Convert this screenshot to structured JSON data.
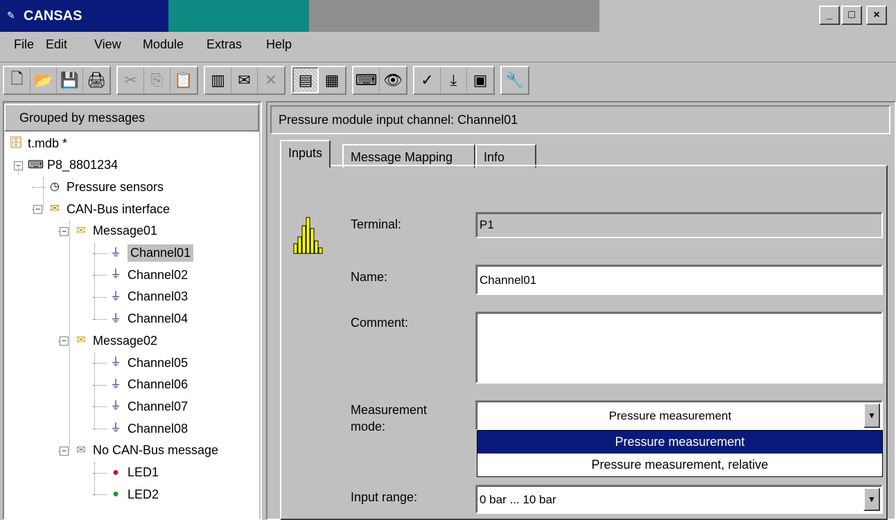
{
  "window": {
    "title": "CANSAS",
    "icon": "cansas-app-icon",
    "controls": [
      "_",
      "□",
      "×"
    ]
  },
  "menu": [
    {
      "label": "File"
    },
    {
      "label": "Edit"
    },
    {
      "label": "View"
    },
    {
      "label": "Module"
    },
    {
      "label": "Extras"
    },
    {
      "label": "Help"
    }
  ],
  "toolbar": {
    "groups": [
      [
        "new-file-icon",
        "open-folder-icon",
        "save-icon",
        "print-icon"
      ],
      [
        "cut-icon",
        "copy-icon",
        "paste-icon"
      ],
      [
        "add-channel-icon",
        "add-message-icon",
        "delete-icon"
      ],
      [
        "group-by-messages-icon",
        "group-by-channels-icon"
      ],
      [
        "module-icon",
        "search-icon"
      ],
      [
        "check-icon",
        "download-icon",
        "display-icon"
      ],
      [
        "wrench-icon"
      ]
    ],
    "glyphs": {
      "new-file-icon": "🗋",
      "open-folder-icon": "📂",
      "save-icon": "💾",
      "print-icon": "🖨",
      "cut-icon": "✂",
      "copy-icon": "⎘",
      "paste-icon": "📋",
      "add-channel-icon": "▥",
      "add-message-icon": "✉",
      "delete-icon": "✕",
      "group-by-messages-icon": "▤",
      "group-by-channels-icon": "▦",
      "module-icon": "⌨",
      "search-icon": "👁",
      "check-icon": "✓",
      "download-icon": "⤓",
      "display-icon": "▣",
      "wrench-icon": "🔧"
    },
    "disabled": [
      "cut-icon",
      "copy-icon",
      "paste-icon",
      "delete-icon",
      "wrench-icon"
    ],
    "pressed": [
      "group-by-messages-icon"
    ]
  },
  "left_panel": {
    "header": "Grouped by messages",
    "tree": [
      {
        "label": "t.mdb *",
        "icon": "database-icon",
        "level": 0
      },
      {
        "label": "P8_8801234",
        "icon": "module-icon",
        "level": 1,
        "expander": "−"
      },
      {
        "label": "Pressure sensors",
        "icon": "gauge-icon",
        "level": 2
      },
      {
        "label": "CAN-Bus interface",
        "icon": "can-bus-icon",
        "level": 2,
        "expander": "−"
      },
      {
        "label": "Message01",
        "icon": "envelope-icon",
        "level": 3,
        "expander": "−"
      },
      {
        "label": "Channel01",
        "icon": "channel-icon",
        "level": 4,
        "selected": true
      },
      {
        "label": "Channel02",
        "icon": "channel-icon",
        "level": 4
      },
      {
        "label": "Channel03",
        "icon": "channel-icon",
        "level": 4
      },
      {
        "label": "Channel04",
        "icon": "channel-icon",
        "level": 4
      },
      {
        "label": "Message02",
        "icon": "envelope-icon",
        "level": 3,
        "expander": "−"
      },
      {
        "label": "Channel05",
        "icon": "channel-icon",
        "level": 4
      },
      {
        "label": "Channel06",
        "icon": "channel-icon",
        "level": 4
      },
      {
        "label": "Channel07",
        "icon": "channel-icon",
        "level": 4
      },
      {
        "label": "Channel08",
        "icon": "channel-icon",
        "level": 4
      },
      {
        "label": "No CAN-Bus message",
        "icon": "no-message-icon",
        "level": 3,
        "expander": "−"
      },
      {
        "label": "LED1",
        "icon": "led-red-icon",
        "level": 4
      },
      {
        "label": "LED2",
        "icon": "led-green-icon",
        "level": 4
      }
    ]
  },
  "right_panel": {
    "header": "Pressure module input channel: Channel01",
    "tabs": [
      {
        "label": "Inputs",
        "active": true
      },
      {
        "label": "Message Mapping"
      },
      {
        "label": "Info"
      }
    ],
    "form": {
      "terminal_label": "Terminal:",
      "terminal_value": "P1",
      "name_label": "Name:",
      "name_value": "Channel01",
      "comment_label": "Comment:",
      "comment_value": "",
      "mode_label_1": "Measurement",
      "mode_label_2": "mode:",
      "mode_value": "Pressure measurement",
      "mode_options": [
        "Pressure measurement",
        "Pressure measurement, relative"
      ],
      "range_label": "Input range:",
      "range_value": "0 bar ... 10 bar"
    }
  },
  "colors": {
    "title_active": "#0a1a7a",
    "title_mid": "#0e8a82",
    "face": "#c0c0c0",
    "highlight": "#0a1a7a"
  }
}
